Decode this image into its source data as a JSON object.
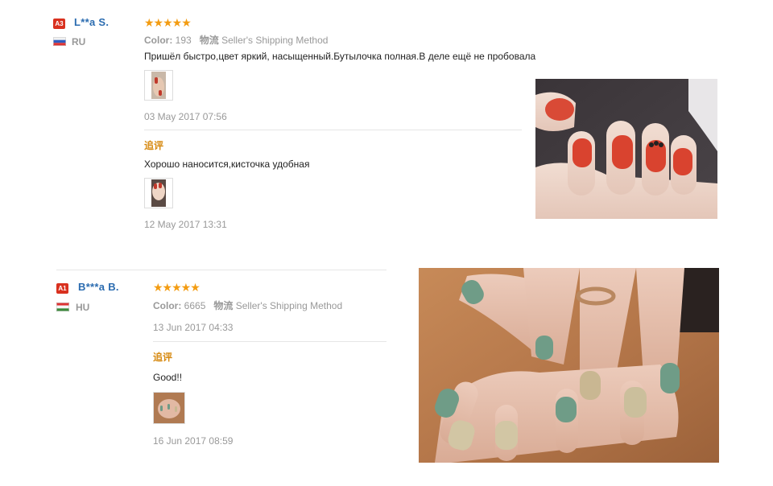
{
  "reviews": [
    {
      "user_badge": "A3",
      "user_name": "L**a S.",
      "country": "RU",
      "stars": "★★★★★",
      "color_label": "Color:",
      "color_value": "193",
      "shipping_label": "物流",
      "shipping_value": "Seller's Shipping Method",
      "text": "Пришёл быстро,цвет яркий, насыщенный.Бутылочка полная.В деле ещё не пробовала",
      "date": "03 May 2017 07:56",
      "followup_label": "追评",
      "followup_text": "Хорошо наносится,кисточка удобная",
      "followup_date": "12 May 2017 13:31"
    },
    {
      "user_badge": "A1",
      "user_name": "B***a B.",
      "country": "HU",
      "stars": "★★★★★",
      "color_label": "Color:",
      "color_value": "6665",
      "shipping_label": "物流",
      "shipping_value": "Seller's Shipping Method",
      "date": "13 Jun 2017 04:33",
      "followup_label": "追评",
      "followup_text": "Good!!",
      "followup_date": "16 Jun 2017 08:59"
    }
  ]
}
